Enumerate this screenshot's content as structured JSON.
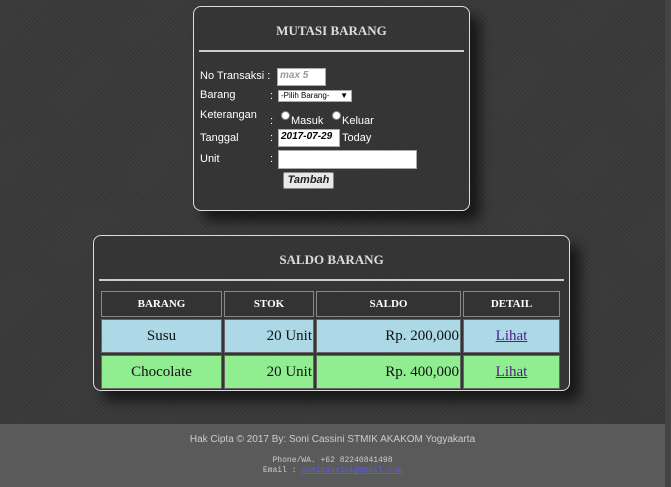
{
  "mutasi": {
    "title": "MUTASI BARANG",
    "fields": {
      "no_transaksi": {
        "label": "No Transaksi :",
        "placeholder": "max 5"
      },
      "barang": {
        "label": "Barang",
        "colon": ":",
        "selected": "-Pilih Barang-"
      },
      "keterangan": {
        "label": "Keterangan",
        "colon": ":",
        "option1": "Masuk",
        "option2": "Keluar"
      },
      "tanggal": {
        "label": "Tanggal",
        "colon": ":",
        "value": "2017-07-29",
        "today": "Today"
      },
      "unit": {
        "label": "Unit",
        "colon": ":",
        "value": ""
      }
    },
    "submit_label": "Tambah"
  },
  "saldo": {
    "title": "SALDO BARANG",
    "headers": [
      "BARANG",
      "STOK",
      "SALDO",
      "DETAIL"
    ],
    "rows": [
      {
        "barang": "Susu",
        "stok": "20 Unit",
        "saldo": "Rp. 200,000",
        "detail": "Lihat"
      },
      {
        "barang": "Chocolate",
        "stok": "20 Unit",
        "saldo": "Rp. 400,000",
        "detail": "Lihat"
      }
    ],
    "row_colors": [
      "#add8e6",
      "#90ee90"
    ]
  },
  "footer": {
    "copyright": "Hak Cipta © 2017 By: Soni Cassini STMIK AKAKOM Yogyakarta",
    "phone": "Phone/WA. +62 82240841498",
    "email_label": "Email :",
    "email": "sonicassini@gmail.com"
  }
}
